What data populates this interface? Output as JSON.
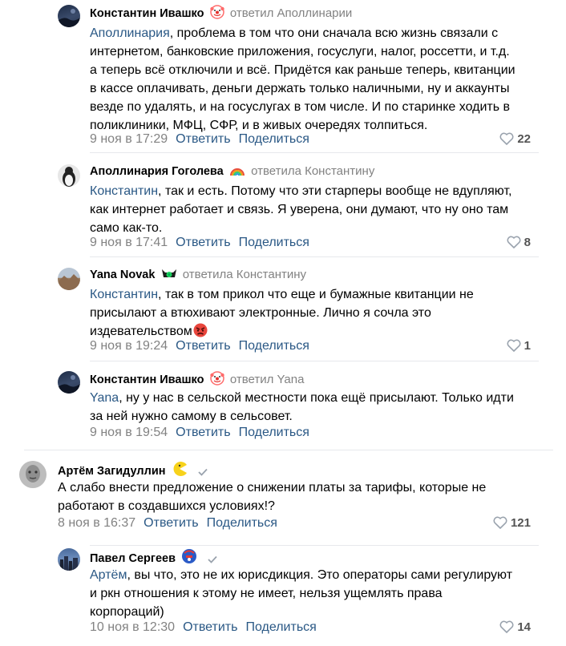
{
  "comments": [
    {
      "author": "Константин Ивашко",
      "reply_to": "ответил Аполлинарии",
      "mention": "Аполлинария",
      "text_lines": [
        ", проблема в том что они сначала всю жизнь связали с",
        "интернетом, банковские приложения, госуслуги, налог, россетти, и т.д.",
        "а теперь всё отключили и всё. Придётся как раньше теперь, квитанции",
        "в кассе оплачивать, деньги держать только наличными, ну и аккаунты",
        "везде по удалять, и на госуслугах в том числе. И по старинке ходить в",
        "поликлиники, МФЦ, СФР, и в живых очередях толпиться."
      ],
      "date": "9 ноя в 17:29",
      "reply_label": "Ответить",
      "share_label": "Поделиться",
      "likes": "22",
      "avatar": "dark-landscape-avatar",
      "badge": "clown-emoji-icon"
    },
    {
      "author": "Аполлинария Гоголева",
      "reply_to": "ответила Константину",
      "mention": "Константин",
      "text_lines": [
        ", так и есть. Потому что эти старперы вообще не вдупляют,",
        "как интернет работает и связь. Я уверена, они думают, что ну оно там",
        "само как-то."
      ],
      "date": "9 ноя в 17:41",
      "reply_label": "Ответить",
      "share_label": "Поделиться",
      "likes": "8",
      "avatar": "penguin-avatar",
      "badge": "rainbow-emoji-icon"
    },
    {
      "author": "Yana Novak",
      "reply_to": "ответила Константину",
      "mention": "Константин",
      "text_lines": [
        ", так в том прикол что еще и бумажные квитанции не",
        "присылают а втюхивают электронные. Лично я сочла это",
        "издевательством"
      ],
      "date": "9 ноя в 19:24",
      "reply_label": "Ответить",
      "share_label": "Поделиться",
      "likes": "1",
      "avatar": "mountain-avatar",
      "badge": "green-eye-icon"
    },
    {
      "author": "Константин Ивашко",
      "reply_to": "ответил Yana",
      "mention": "Yana",
      "text_lines": [
        ", ну у нас в сельской местности пока ещё присылают. Только идти",
        "за ней нужно самому в сельсовет."
      ],
      "date": "9 ноя в 19:54",
      "reply_label": "Ответить",
      "share_label": "Поделиться",
      "likes": "",
      "avatar": "dark-landscape-avatar",
      "badge": "clown-emoji-icon"
    },
    {
      "author": "Артём Загидуллин",
      "reply_to": "",
      "mention": "",
      "text_lines": [
        "А слабо внести предложение о снижении платы за тарифы, которые не",
        "работают в создавшихся условиях!?"
      ],
      "date": "8 ноя в 16:37",
      "reply_label": "Ответить",
      "share_label": "Поделиться",
      "likes": "121",
      "avatar": "grey-face-avatar",
      "badge": "pacman-icon"
    },
    {
      "author": "Павел Сергеев",
      "reply_to": "",
      "mention": "Артём",
      "text_lines": [
        ", вы что, это не их юрисдикция. Это операторы сами регулируют",
        "и ркн отношения к этому не имеет, нельзя ущемлять права",
        "корпораций)"
      ],
      "date": "10 ноя в 12:30",
      "reply_label": "Ответить",
      "share_label": "Поделиться",
      "likes": "14",
      "avatar": "city-avatar",
      "badge": "captain-helmet-icon"
    }
  ],
  "colors": {
    "link": "#2a5885",
    "muted": "#828282",
    "divider": "#e7e8ec"
  }
}
